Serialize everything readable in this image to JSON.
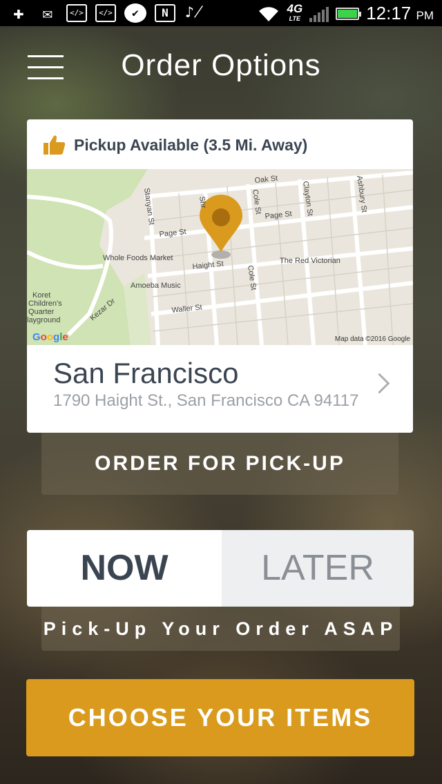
{
  "status_bar": {
    "time": "12:17",
    "ampm": "PM",
    "network": "4G",
    "network_sub": "LTE",
    "left_icons": [
      "add-icon",
      "gmail-icon",
      "code-icon",
      "code-icon",
      "check-app-icon",
      "nfc-icon",
      "mute-icon",
      "wifi-icon"
    ]
  },
  "header": {
    "title": "Order Options"
  },
  "location_card": {
    "pickup_status": "Pickup Available (3.5 Mi. Away)",
    "map": {
      "streets": [
        "Oak St",
        "Page St",
        "Page St",
        "Haight St",
        "Waller St",
        "Stanyan St",
        "Cole St",
        "Cole St",
        "Clayton St",
        "Ashbury St",
        "Kezar Dr",
        "Shr"
      ],
      "places": [
        "Whole Foods Market",
        "Amoeba Music",
        "The Red Victorian",
        "Koret Children's Quarter Playground"
      ],
      "copyright": "Map data ©2016 Google",
      "logo": "Google"
    },
    "name": "San Francisco",
    "address": "1790 Haight St., San Francisco CA 94117"
  },
  "order_type_label": "ORDER FOR PICK-UP",
  "time_toggle": {
    "now": "NOW",
    "later": "LATER",
    "selected": "now"
  },
  "asap_label": "Pick-Up Your Order ASAP",
  "cta_label": "CHOOSE YOUR ITEMS",
  "colors": {
    "accent": "#d99a1d",
    "text_dark": "#3b4552",
    "text_muted": "#9ba0a6"
  }
}
